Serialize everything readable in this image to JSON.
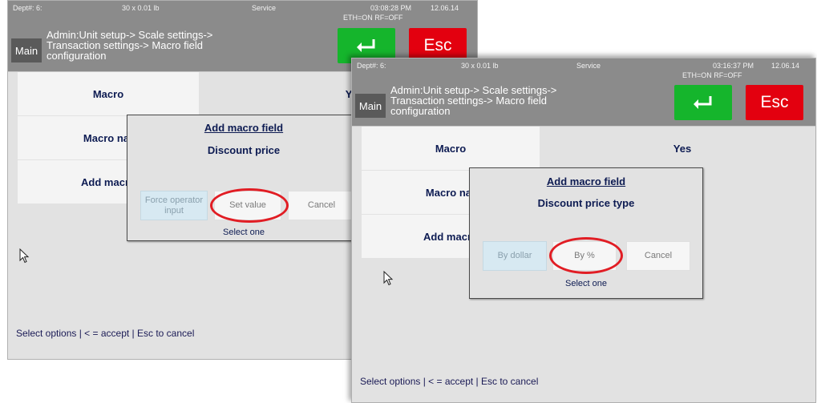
{
  "back_screen": {
    "status": {
      "dept": "Dept#: 6:",
      "unit": "30 x 0.01 lb",
      "mode": "Service",
      "time": "03:08:28 PM",
      "date": "12.06.14",
      "net": "ETH=ON RF=OFF"
    },
    "main_label": "Main",
    "breadcrumb": [
      "Admin:Unit setup-> Scale settings->",
      "Transaction settings-> Macro field",
      "configuration"
    ],
    "esc_label": "Esc",
    "rows": [
      {
        "label": "Macro",
        "value": "Yes"
      },
      {
        "label": "Macro nar"
      },
      {
        "label": "Add macro"
      }
    ],
    "dialog": {
      "title": "Add macro field",
      "subtitle": "Discount price",
      "buttons": [
        "Force operator input",
        "Set value",
        "Cancel"
      ],
      "hint": "Select one"
    },
    "footer": "Select options | < = accept | Esc to cancel"
  },
  "front_screen": {
    "status": {
      "dept": "Dept#: 6:",
      "unit": "30 x 0.01 lb",
      "mode": "Service",
      "time": "03:16:37 PM",
      "date": "12.06.14",
      "net": "ETH=ON RF=OFF"
    },
    "main_label": "Main",
    "breadcrumb": [
      "Admin:Unit setup-> Scale settings->",
      "Transaction settings-> Macro field",
      "configuration"
    ],
    "esc_label": "Esc",
    "rows": [
      {
        "label": "Macro",
        "value": "Yes"
      },
      {
        "label": "Macro nar"
      },
      {
        "label": "Add macro"
      }
    ],
    "dialog": {
      "title": "Add macro field",
      "subtitle": "Discount price type",
      "buttons": [
        "By dollar",
        "By %",
        "Cancel"
      ],
      "hint": "Select one"
    },
    "footer": "Select options | < = accept | Esc to cancel"
  },
  "colors": {
    "accent_green": "#15b52c",
    "esc_red": "#e3000f",
    "highlight_circle": "#e11d24",
    "text_navy": "#0d1b52"
  }
}
